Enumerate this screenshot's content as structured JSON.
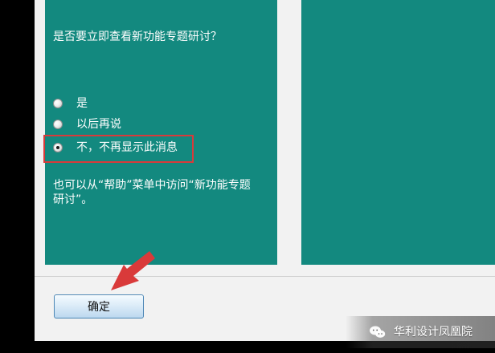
{
  "dialog": {
    "question": "是否要立即查看新功能专题研讨？",
    "options": [
      {
        "label": "是",
        "selected": false
      },
      {
        "label": "以后再说",
        "selected": false
      },
      {
        "label": "不，不再显示此消息",
        "selected": true
      }
    ],
    "hint": "也可以从“帮助”菜单中访问“新功能专题研讨”。",
    "ok_label": "确定"
  },
  "watermark": {
    "text": "华利设计凤凰院"
  },
  "colors": {
    "panel": "#13897f",
    "dialog": "#f2f2f2",
    "highlight": "#d93a3a",
    "arrow": "#d93a3a"
  },
  "icons": {
    "arrow": "arrow-icon",
    "radio": "radio-icon",
    "watermark": "wechat-logo-icon"
  }
}
